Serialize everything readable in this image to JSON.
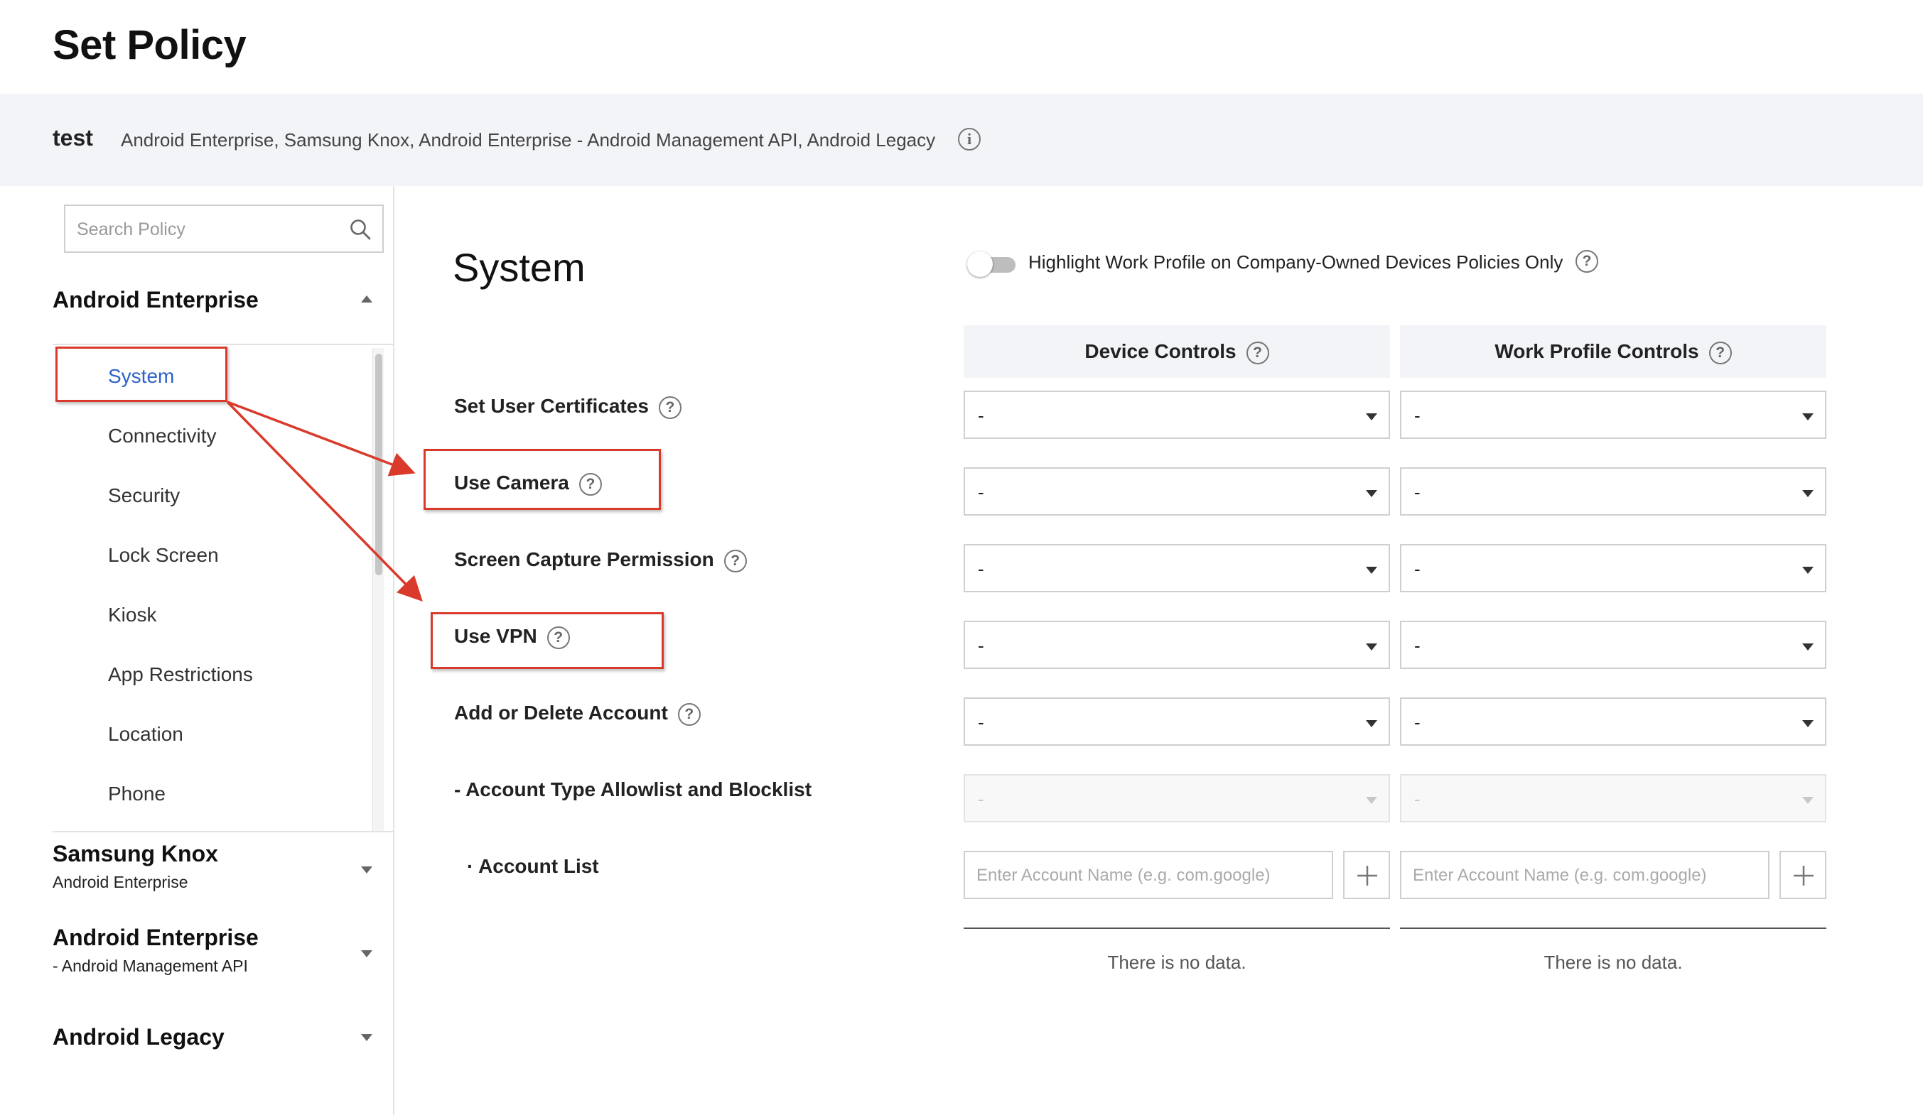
{
  "header": {
    "title": "Set Policy"
  },
  "policy_bar": {
    "name": "test",
    "platforms": "Android Enterprise, Samsung Knox, Android Enterprise - Android Management API, Android Legacy"
  },
  "sidebar": {
    "search_placeholder": "Search Policy",
    "groups": [
      {
        "title": "Android Enterprise",
        "subtitle": "",
        "expanded": true
      },
      {
        "title": "Samsung Knox",
        "subtitle": "Android Enterprise",
        "expanded": false
      },
      {
        "title": "Android Enterprise",
        "subtitle": "- Android Management API",
        "expanded": false
      },
      {
        "title": "Android Legacy",
        "subtitle": "",
        "expanded": false
      }
    ],
    "items": [
      {
        "label": "System",
        "active": true
      },
      {
        "label": "Connectivity"
      },
      {
        "label": "Security"
      },
      {
        "label": "Lock Screen"
      },
      {
        "label": "Kiosk"
      },
      {
        "label": "App Restrictions"
      },
      {
        "label": "Location"
      },
      {
        "label": "Phone"
      }
    ]
  },
  "main": {
    "section_title": "System",
    "toggle_label": "Highlight Work Profile on Company-Owned Devices Policies Only",
    "toggle_on": false,
    "columns": [
      "Device Controls",
      "Work Profile Controls"
    ],
    "rows": [
      {
        "label": "Set User Certificates",
        "device": "-",
        "work": "-"
      },
      {
        "label": "Use Camera",
        "device": "-",
        "work": "-"
      },
      {
        "label": "Screen Capture Permission",
        "device": "-",
        "work": "-"
      },
      {
        "label": "Use VPN",
        "device": "-",
        "work": "-"
      },
      {
        "label": "Add or Delete Account",
        "device": "-",
        "work": "-"
      },
      {
        "label": "- Account Type Allowlist and Blocklist",
        "device": "-",
        "work": "-"
      }
    ],
    "account_list": {
      "label": "· Account List",
      "placeholder": "Enter Account Name (e.g. com.google)",
      "empty_text": "There is no data."
    }
  },
  "annotation_color": "#d93a2b",
  "accent_color": "#2d63c8"
}
